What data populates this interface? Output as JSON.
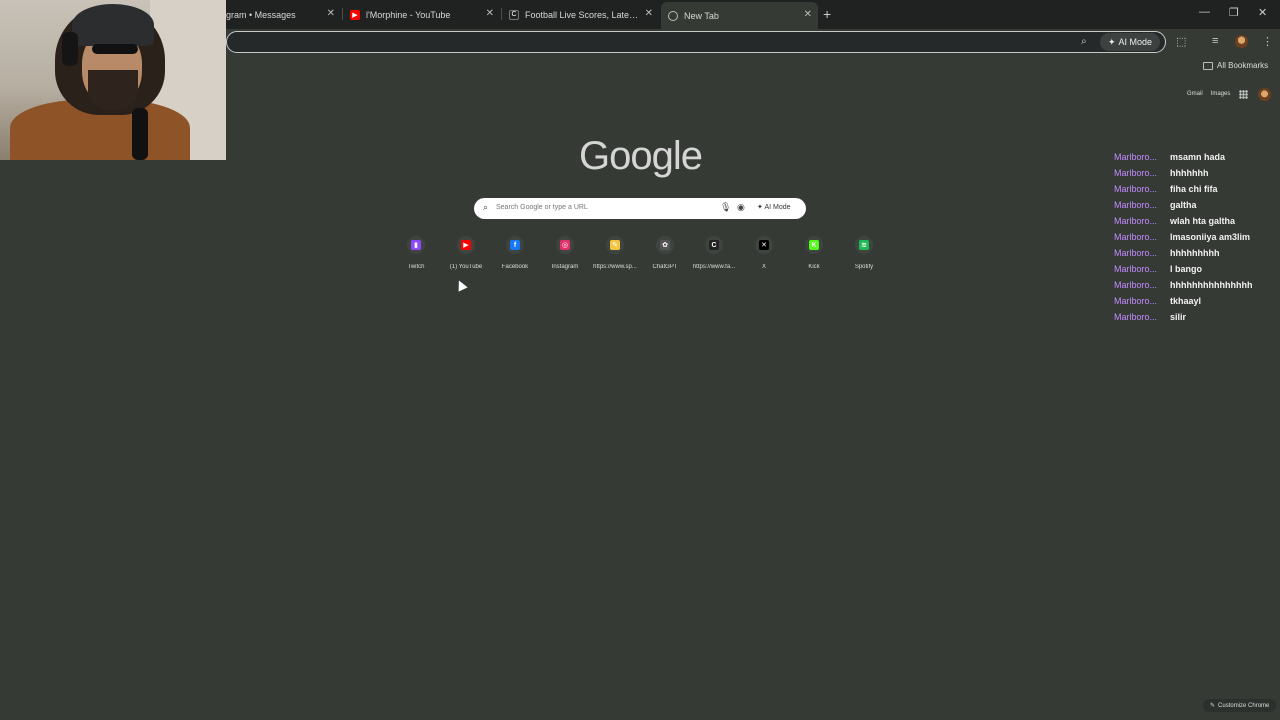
{
  "tabs": [
    {
      "title": "gram • Messages",
      "favicon": "instagram-icon",
      "active": false
    },
    {
      "title": "l'Morphine - YouTube",
      "favicon": "youtube-icon",
      "active": false
    },
    {
      "title": "Football Live Scores, Latest Foo",
      "favicon": "fotmob-icon",
      "active": false
    },
    {
      "title": "New Tab",
      "favicon": "chrome-icon",
      "active": true
    }
  ],
  "toolbar": {
    "ai_mode_label": "AI Mode",
    "bookmarks_label": "All Bookmarks"
  },
  "google": {
    "logo": "Google",
    "links": [
      "Gmail",
      "Images"
    ],
    "search_placeholder": "Search Google or type a URL",
    "ai_mode_label": "AI Mode"
  },
  "shortcuts": [
    {
      "label": "Twitch",
      "icon": "twitch-icon",
      "color": "#9146ff",
      "glyph": "▮"
    },
    {
      "label": "(1) YouTube",
      "icon": "youtube-icon",
      "color": "#ff0000",
      "glyph": "▶"
    },
    {
      "label": "Facebook",
      "icon": "facebook-icon",
      "color": "#1877f2",
      "glyph": "f"
    },
    {
      "label": "Instagram",
      "icon": "instagram-icon",
      "color": "#e1306c",
      "glyph": "◎"
    },
    {
      "label": "https://www.sp...",
      "icon": "notes-icon",
      "color": "#f4c542",
      "glyph": "✎"
    },
    {
      "label": "ChatGPT",
      "icon": "chatgpt-icon",
      "color": "#555555",
      "glyph": "✿"
    },
    {
      "label": "https://www.fa...",
      "icon": "fotmob-icon",
      "color": "#222222",
      "glyph": "C"
    },
    {
      "label": "X",
      "icon": "x-icon",
      "color": "#000000",
      "glyph": "✕"
    },
    {
      "label": "Kick",
      "icon": "kick-icon",
      "color": "#53fc18",
      "glyph": "K"
    },
    {
      "label": "Spotify",
      "icon": "spotify-icon",
      "color": "#1db954",
      "glyph": "≋"
    }
  ],
  "chat": [
    {
      "user": "Marlboro...",
      "message": "msamn hada"
    },
    {
      "user": "Marlboro...",
      "message": "hhhhhhh"
    },
    {
      "user": "Marlboro...",
      "message": "fiha chi fifa"
    },
    {
      "user": "Marlboro...",
      "message": "galtha"
    },
    {
      "user": "Marlboro...",
      "message": "wlah hta galtha"
    },
    {
      "user": "Marlboro...",
      "message": "lmasoniiya am3lim"
    },
    {
      "user": "Marlboro...",
      "message": "hhhhhhhhh"
    },
    {
      "user": "Marlboro...",
      "message": "l bango"
    },
    {
      "user": "Marlboro...",
      "message": "hhhhhhhhhhhhhhh"
    },
    {
      "user": "Marlboro...",
      "message": "tkhaayl"
    },
    {
      "user": "Marlboro...",
      "message": "silir"
    }
  ],
  "customize_label": "Customize Chrome",
  "colors": {
    "page_bg": "#353a35",
    "tabstrip_bg": "#1f2220",
    "chat_username": "#c08bff"
  }
}
